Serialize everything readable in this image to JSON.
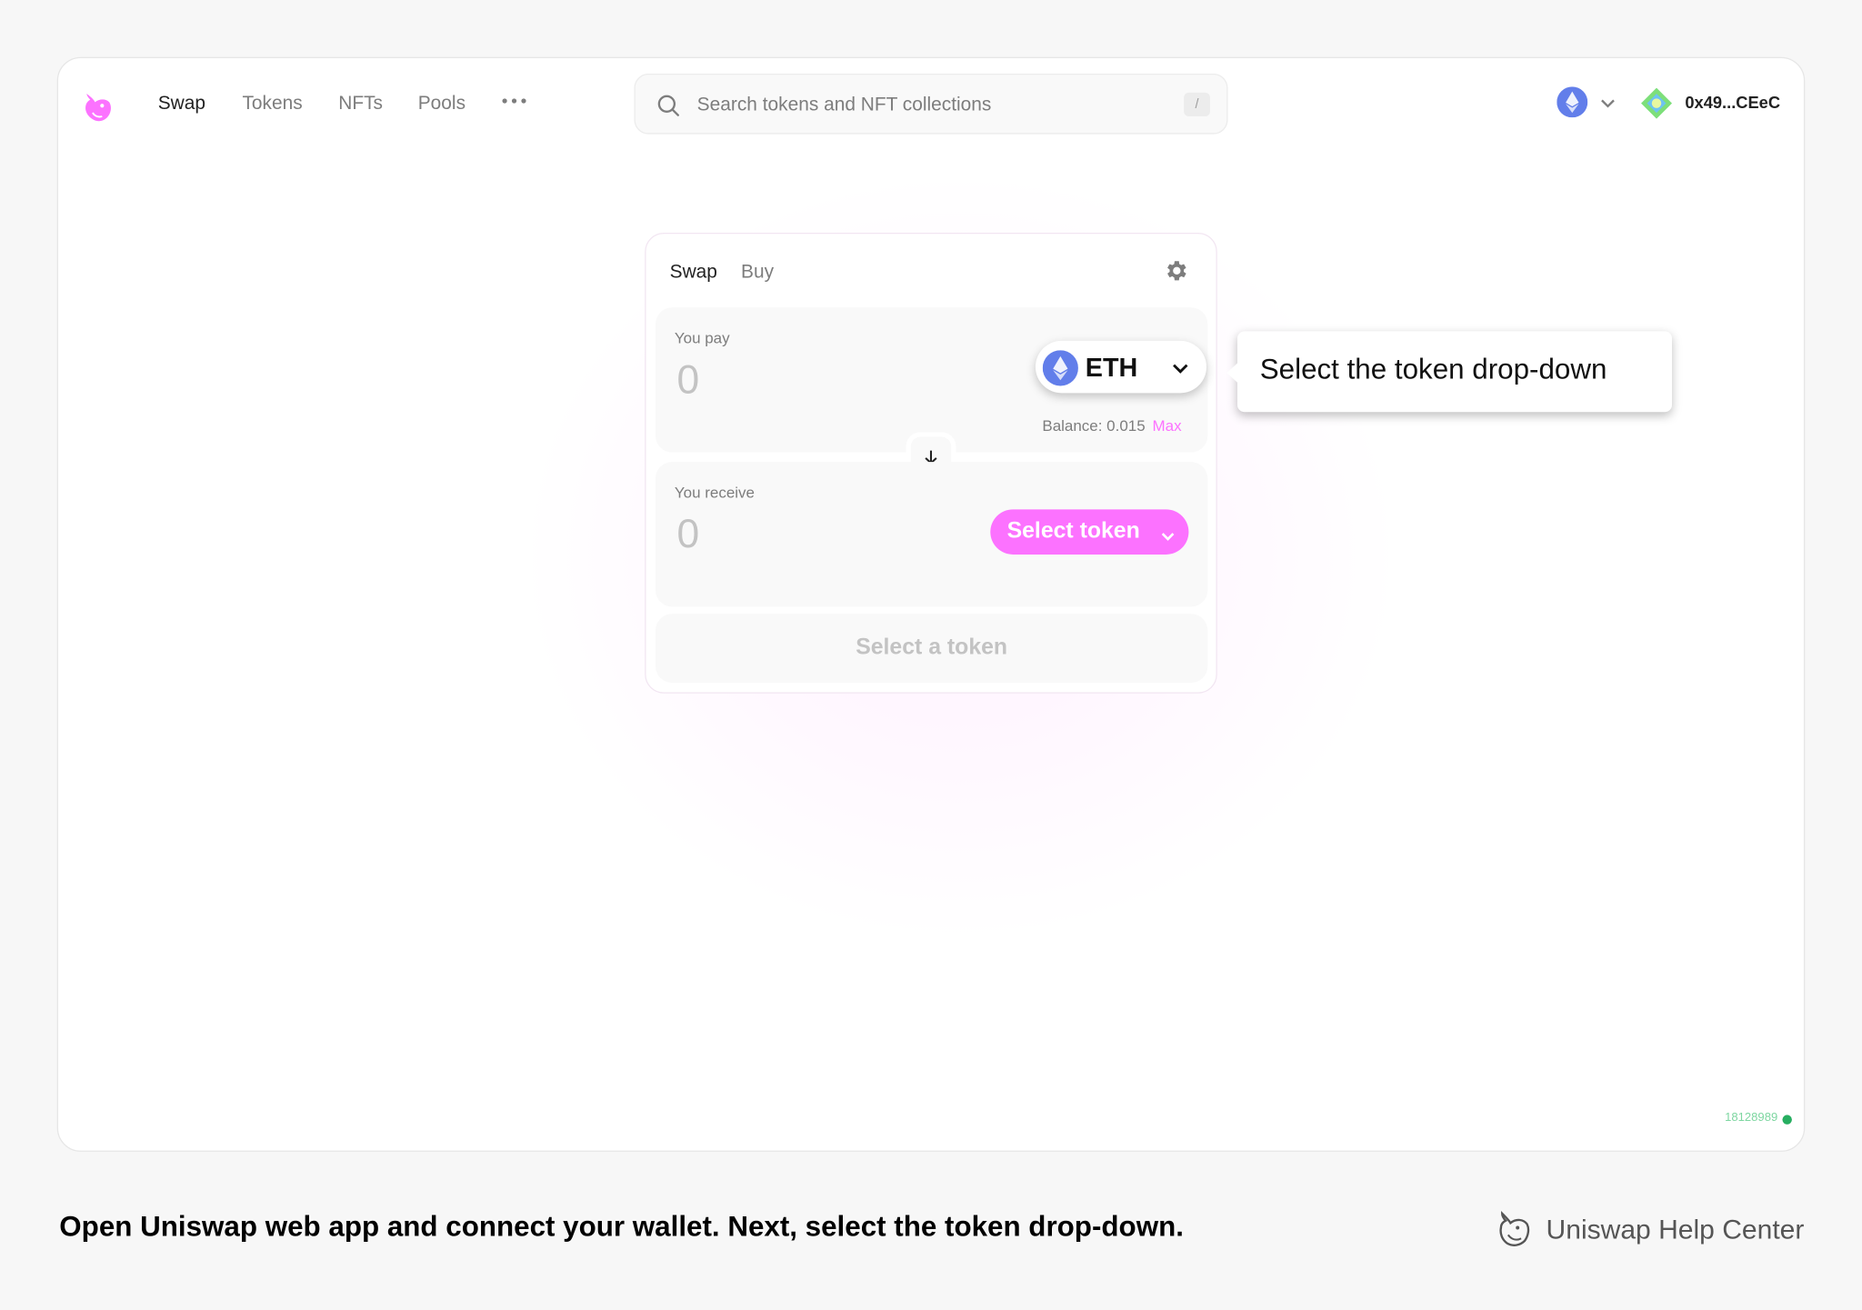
{
  "nav": {
    "items": [
      {
        "label": "Swap",
        "active": true
      },
      {
        "label": "Tokens",
        "active": false
      },
      {
        "label": "NFTs",
        "active": false
      },
      {
        "label": "Pools",
        "active": false
      }
    ],
    "more_icon": "more-horizontal-icon"
  },
  "search": {
    "placeholder": "Search tokens and NFT collections",
    "shortcut": "/"
  },
  "network": {
    "icon": "ethereum-icon"
  },
  "account": {
    "address": "0x49...CEeC"
  },
  "swap": {
    "tabs": [
      {
        "label": "Swap"
      },
      {
        "label": "Buy"
      }
    ],
    "pay": {
      "label": "You pay",
      "amount_placeholder": "0",
      "token": "ETH",
      "balance": "Balance: 0.015",
      "max": "Max"
    },
    "receive": {
      "label": "You receive",
      "amount_placeholder": "0",
      "select_label": "Select token"
    },
    "action": "Select a token"
  },
  "callout": {
    "text": "Select the token drop-down"
  },
  "status": {
    "block": "18128989"
  },
  "footer": {
    "caption": "Open Uniswap web app and connect your wallet. Next, select the token drop-down.",
    "brand": "Uniswap Help Center"
  },
  "colors": {
    "accent": "#fc72ff",
    "eth": "#627eea",
    "status_ok": "#27ae60"
  }
}
